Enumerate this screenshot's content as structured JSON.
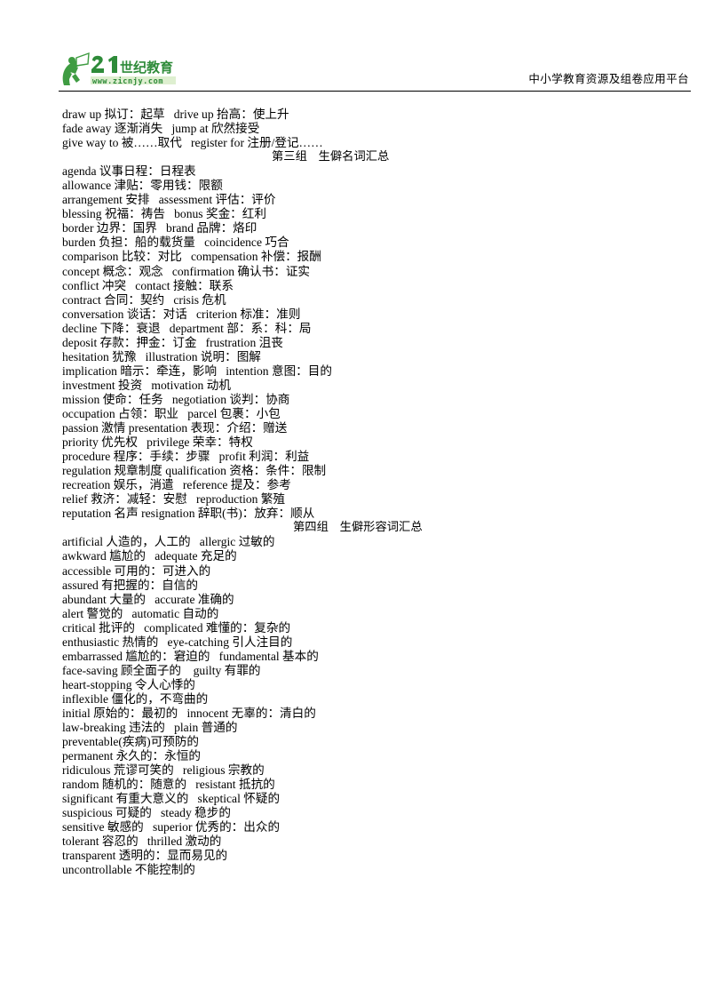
{
  "header": {
    "logo": {
      "brand_number": "21",
      "brand_cn": "世纪教育",
      "brand_url": "www.zicnjy.com",
      "green_dark": "#1f7a33",
      "green_light": "#7ac143"
    },
    "tagline": "中小学教育资源及组卷应用平台"
  },
  "content": {
    "phrase_lines": [
      "draw up 拟订：起草   drive up 抬高：使上升",
      "fade away 逐渐消失   jump at 欣然接受",
      "give way to 被……取代   register for 注册/登记……"
    ],
    "group3_heading": "第三组   生僻名词汇总",
    "noun_lines": [
      "agenda 议事日程：日程表",
      "allowance 津贴：零用钱：限额",
      "arrangement 安排   assessment 评估：评价",
      "blessing 祝福：祷告   bonus 奖金：红利",
      "border 边界：国界   brand 品牌：烙印",
      "burden 负担：船的载货量   coincidence 巧合",
      "comparison 比较：对比   compensation 补偿：报酬",
      "concept 概念：观念   confirmation 确认书：证实",
      "conflict 冲突   contact 接触：联系",
      "contract 合同：契约   crisis 危机",
      "conversation 谈话：对话   criterion 标准：准则",
      "decline 下降：衰退   department 部：系：科：局",
      "deposit 存款：押金：订金   frustration 沮丧",
      "hesitation 犹豫   illustration 说明：图解",
      "implication 暗示：牵连，影响   intention 意图：目的",
      "investment 投资   motivation 动机",
      "mission 使命：任务   negotiation 谈判：协商",
      "occupation 占领：职业   parcel 包裹：小包",
      "passion 激情 presentation 表现：介绍：赠送",
      "priority 优先权   privilege 荣幸：特权",
      "procedure 程序：手续：步骤   profit 利润：利益",
      "regulation 规章制度 qualification 资格：条件：限制",
      "recreation 娱乐，消遣   reference 提及：参考",
      "relief 救济：减轻：安慰   reproduction 繁殖",
      "reputation 名声 resignation 辞职(书)：放弃：顺从"
    ],
    "group4_heading": "第四组   生僻形容词汇总",
    "adjective_lines": [
      "artificial 人造的，人工的   allergic 过敏的",
      "awkward 尴尬的   adequate 充足的",
      "accessible 可用的：可进入的",
      "assured 有把握的：自信的",
      "abundant 大量的   accurate 准确的",
      "alert 警觉的   automatic 自动的",
      "critical 批评的   complicated 难懂的：复杂的",
      "enthusiastic 热情的   eye-catching 引人注目的",
      "embarrassed 尴尬的：窘迫的   fundamental 基本的",
      "face-saving 顾全面子的    guilty 有罪的",
      "heart-stopping 令人心悸的",
      "inflexible 僵化的，不弯曲的",
      "initial 原始的：最初的   innocent 无辜的：清白的",
      "law-breaking 违法的   plain 普通的",
      "preventable(疾病)可预防的",
      "permanent 永久的：永恒的",
      "ridiculous 荒谬可笑的   religious 宗教的",
      "random 随机的：随意的   resistant 抵抗的",
      "significant 有重大意义的   skeptical 怀疑的",
      "suspicious 可疑的   steady 稳步的",
      "sensitive 敏感的   superior 优秀的：出众的",
      "tolerant 容忍的   thrilled 激动的",
      "transparent 透明的：显而易见的",
      "uncontrollable 不能控制的"
    ]
  }
}
